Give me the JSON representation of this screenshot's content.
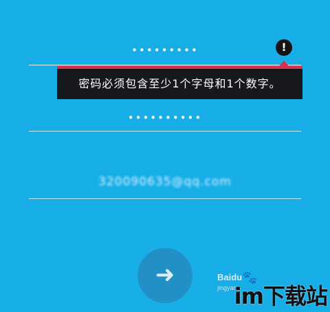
{
  "form": {
    "password_value": "•••••••••",
    "confirm_value": "••••••••••",
    "email_value": "320090635@qq.com"
  },
  "error": {
    "icon_glyph": "!",
    "message": "密码必须包含至少1个字母和1个数字。",
    "accent_color": "#d9304c"
  },
  "actions": {
    "next_glyph": "➜"
  },
  "watermark": {
    "baidu": "Baidu",
    "paw_glyph": "🐾",
    "jingyan": "jingyan",
    "site": "im下载站"
  },
  "colors": {
    "background": "#17aee8",
    "button": "#2290c4",
    "tooltip_bg": "#17181c"
  }
}
